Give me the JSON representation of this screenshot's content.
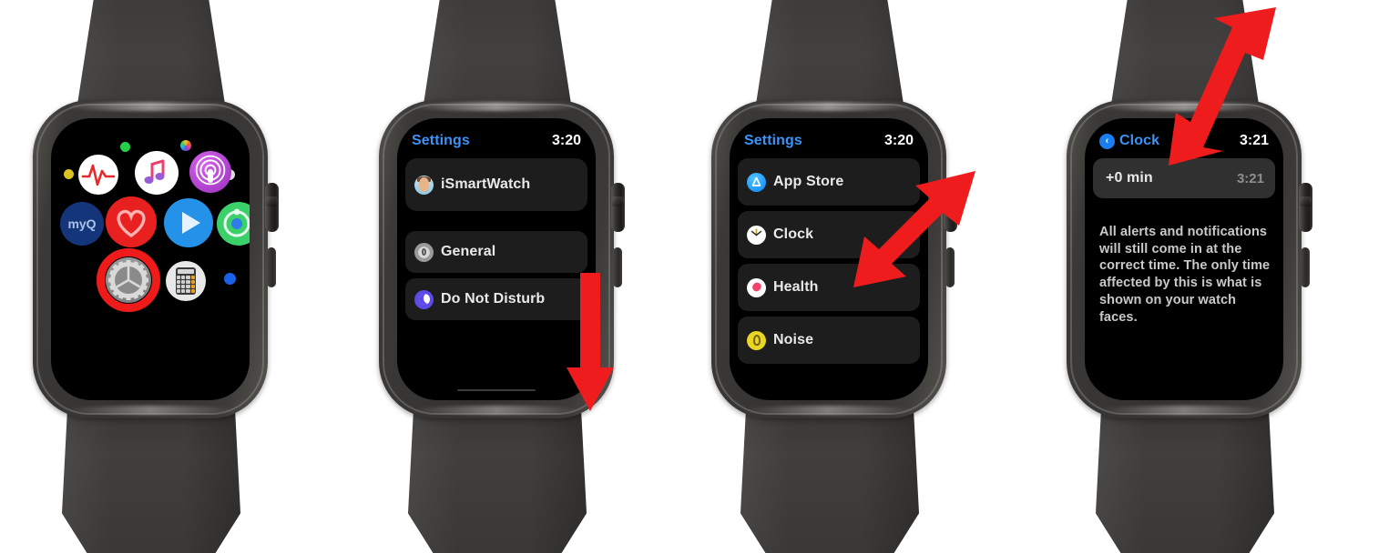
{
  "watches": [
    {
      "id": "watch-home-screen",
      "screen_type": "app-grid",
      "apps": [
        {
          "name": "ecg-app-icon",
          "label": "ECG"
        },
        {
          "name": "music-app-icon",
          "label": "Music"
        },
        {
          "name": "podcasts-app-icon",
          "label": "Podcasts"
        },
        {
          "name": "myq-app-icon",
          "label": "myQ"
        },
        {
          "name": "heart-rate-app-icon",
          "label": "Heart Rate"
        },
        {
          "name": "now-playing-app-icon",
          "label": "Now Playing"
        },
        {
          "name": "find-people-app-icon",
          "label": "Find People"
        },
        {
          "name": "settings-app-icon",
          "label": "Settings"
        },
        {
          "name": "calculator-app-icon",
          "label": "Calculator"
        },
        {
          "name": "photos-app-icon",
          "label": "Photos"
        },
        {
          "name": "reminders-app-icon",
          "label": "Reminders"
        }
      ],
      "highlighted_app": "settings-app-icon"
    },
    {
      "id": "watch-settings-list-1",
      "screen_type": "list",
      "header": {
        "title": "Settings",
        "time": "3:20",
        "back": false
      },
      "rows": [
        {
          "icon": "avatar-icon",
          "label": "iSmartWatch",
          "value": ""
        },
        {
          "icon": "general-gear-icon",
          "label": "General",
          "value": ""
        },
        {
          "icon": "do-not-disturb-icon",
          "label": "Do Not Disturb",
          "value": ""
        }
      ],
      "home_indicator": true,
      "arrow": "scroll-down-arrow"
    },
    {
      "id": "watch-settings-list-2",
      "screen_type": "list",
      "header": {
        "title": "Settings",
        "time": "3:20",
        "back": false
      },
      "rows": [
        {
          "icon": "app-store-icon",
          "label": "App Store",
          "value": ""
        },
        {
          "icon": "clock-icon",
          "label": "Clock",
          "value": ""
        },
        {
          "icon": "health-icon",
          "label": "Health",
          "value": ""
        },
        {
          "icon": "noise-icon",
          "label": "Noise",
          "value": ""
        }
      ],
      "home_indicator": false,
      "arrow": "clock-row-pointer-arrow"
    },
    {
      "id": "watch-clock-settings",
      "screen_type": "detail",
      "header": {
        "title": "Clock",
        "time": "3:21",
        "back": true,
        "back_glyph": "‹"
      },
      "rows": [
        {
          "icon": "",
          "label": "+0 min",
          "value": "3:21"
        }
      ],
      "body_text": "All alerts and notifications will still come in at the correct time. The only time affected by this is what is shown on your watch faces.",
      "home_indicator": false,
      "arrow": "offset-row-pointer-arrow"
    }
  ],
  "colors": {
    "accent_blue": "#3b93f7",
    "arrow_red": "#ef1b1b",
    "highlight_ring_red": "#ef1b1b",
    "row_background": "#1d1d1d",
    "screen_background": "#000000",
    "case_gray": "#3b3937",
    "band_gray": "#3a3836"
  }
}
